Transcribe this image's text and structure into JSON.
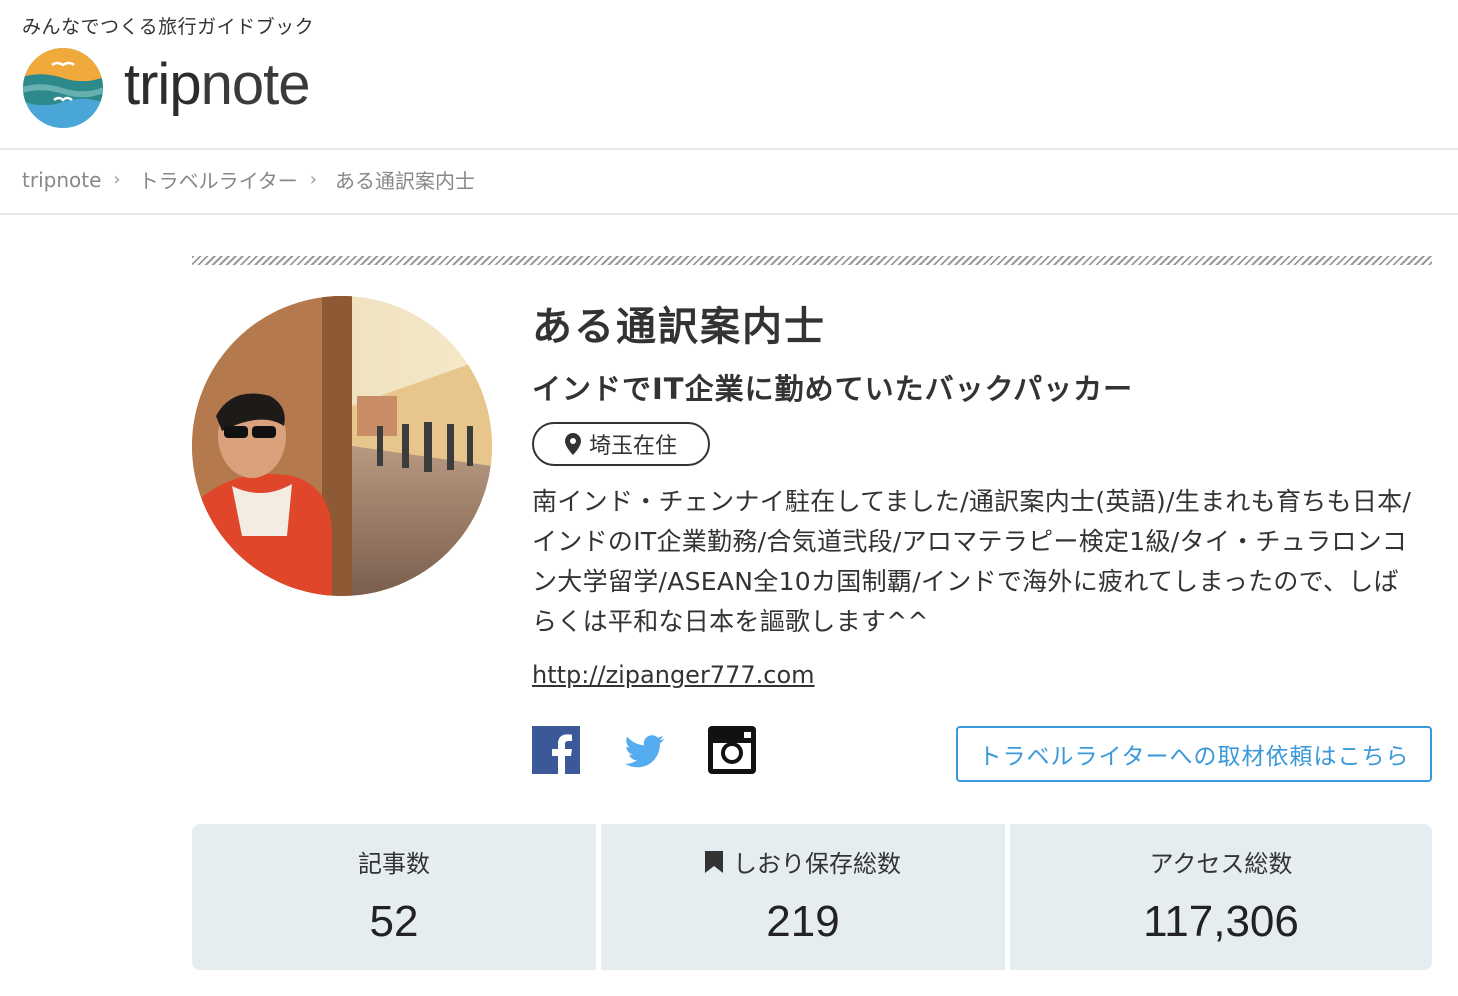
{
  "site": {
    "tagline": "みんなでつくる旅行ガイドブック",
    "logo_text_bold": "trip",
    "logo_text_light": "note"
  },
  "breadcrumb": [
    {
      "label": "tripnote"
    },
    {
      "label": "トラベルライター"
    },
    {
      "label": "ある通訳案内士"
    }
  ],
  "profile": {
    "name": "ある通訳案内士",
    "catchphrase": "インドでIT企業に勤めていたバックパッカー",
    "location": "埼玉在住",
    "bio": "南インド・チェンナイ駐在してました/通訳案内士(英語)/生まれも育ちも日本/インドのIT企業勤務/合気道弐段/アロマテラピー検定1級/タイ・チュラロンコン大学留学/ASEAN全10カ国制覇/インドで海外に疲れてしまったので、しばらくは平和な日本を謳歌します^^",
    "url": "http://zipanger777.com",
    "request_button": "トラベルライターへの取材依頼はこちら"
  },
  "social": [
    {
      "name": "facebook-icon",
      "color": "#3b5998"
    },
    {
      "name": "twitter-icon",
      "color": "#55acee"
    },
    {
      "name": "instagram-icon",
      "color": "#111111"
    }
  ],
  "stats": [
    {
      "label": "記事数",
      "value": "52"
    },
    {
      "label": "しおり保存総数",
      "value": "219",
      "icon": "bookmark-icon"
    },
    {
      "label": "アクセス総数",
      "value": "117,306"
    }
  ],
  "colors": {
    "accent": "#3a9ad9",
    "stat_bg": "#e6edf1",
    "logo_orange": "#f0a93b",
    "logo_teal": "#2e8a8a",
    "logo_blue": "#4aa6d6"
  }
}
